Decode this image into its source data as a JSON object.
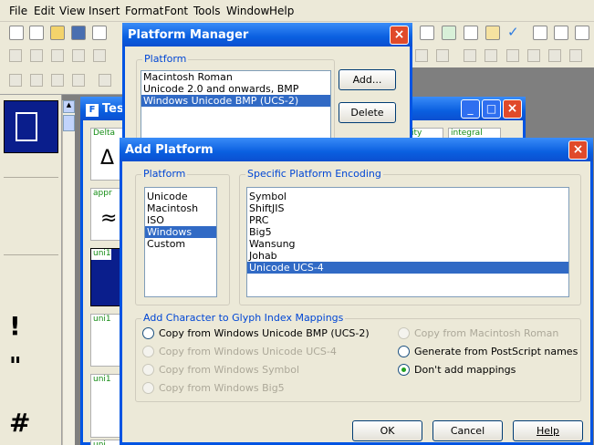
{
  "menu": [
    "File",
    "Edit",
    "View",
    "Insert",
    "Format",
    "Font",
    "Tools",
    "Window",
    "Help"
  ],
  "palette": {
    "glyph1": "!",
    "glyph2": "\"",
    "glyph3": "#"
  },
  "fontwin": {
    "title": "Tes",
    "cells": [
      {
        "tag": "Delta",
        "glyph": "Δ"
      },
      {
        "tag": "appr",
        "glyph": "≈"
      },
      {
        "tag": "uni1",
        "glyph": ""
      },
      {
        "tag": "uni1",
        "glyph": ""
      },
      {
        "tag": "uni1",
        "glyph": ""
      },
      {
        "tag": "uni",
        "glyph": ""
      }
    ],
    "right_tags": [
      "ity",
      "integral"
    ]
  },
  "platform_manager": {
    "title": "Platform Manager",
    "group": "Platform",
    "items": [
      "Macintosh Roman",
      "Unicode 2.0 and onwards, BMP",
      "Windows Unicode BMP (UCS-2)"
    ],
    "selected": 2,
    "add": "Add...",
    "delete": "Delete"
  },
  "add_platform": {
    "title": "Add Platform",
    "platform_label": "Platform",
    "platforms": [
      "Unicode",
      "Macintosh",
      "ISO",
      "Windows",
      "Custom"
    ],
    "platform_selected": 3,
    "encoding_label": "Specific Platform Encoding",
    "encodings": [
      "Symbol",
      "ShiftJIS",
      "PRC",
      "Big5",
      "Wansung",
      "Johab",
      "Unicode UCS-4"
    ],
    "encoding_selected": 6,
    "mapping_label": "Add Character to Glyph Index Mappings",
    "options_left": [
      {
        "label": "Copy from Windows Unicode BMP (UCS-2)",
        "enabled": true
      },
      {
        "label": "Copy from Windows Unicode UCS-4",
        "enabled": false
      },
      {
        "label": "Copy from Windows Symbol",
        "enabled": false
      },
      {
        "label": "Copy from Windows Big5",
        "enabled": false
      }
    ],
    "options_right": [
      {
        "label": "Copy from Macintosh Roman",
        "enabled": false
      },
      {
        "label": "Generate from PostScript names",
        "enabled": true
      },
      {
        "label": "Don't add mappings",
        "enabled": true,
        "checked": true
      }
    ],
    "ok": "OK",
    "cancel": "Cancel",
    "help": "Help"
  }
}
